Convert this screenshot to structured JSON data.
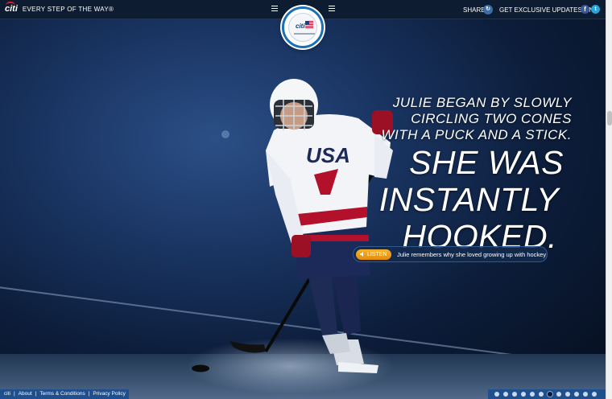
{
  "topbar": {
    "brand_logo": "citi",
    "brand_tagline": "EVERY STEP OF THE WAY®",
    "share_label": "SHARE",
    "updates_label": "GET EXCLUSIVE UPDATES ON",
    "icons": [
      "menu-icon",
      "share-icon",
      "facebook-icon",
      "twitter-icon"
    ]
  },
  "badge": {
    "brand": "citi"
  },
  "headline": {
    "lead_line1": "JULIE BEGAN BY SLOWLY",
    "lead_line2": "CIRCLING TWO CONES",
    "lead_line3": "WITH A PUCK AND A STICK.",
    "big_line1": "SHE WAS",
    "big_line2": "INSTANTLY",
    "big_line3": "HOOKED."
  },
  "listen": {
    "button_label": "LISTEN",
    "caption": "Julie remembers why she loved growing up with hockey"
  },
  "footer": {
    "logo": "citi",
    "links": [
      "About",
      "Terms & Conditions",
      "Privacy Policy"
    ],
    "separator": "|"
  },
  "pagination": {
    "total": 12,
    "active_index": 6
  },
  "colors": {
    "accent_blue": "#1f4f8c",
    "listen_orange": "#f0a01a",
    "citi_red": "#e41b23"
  }
}
